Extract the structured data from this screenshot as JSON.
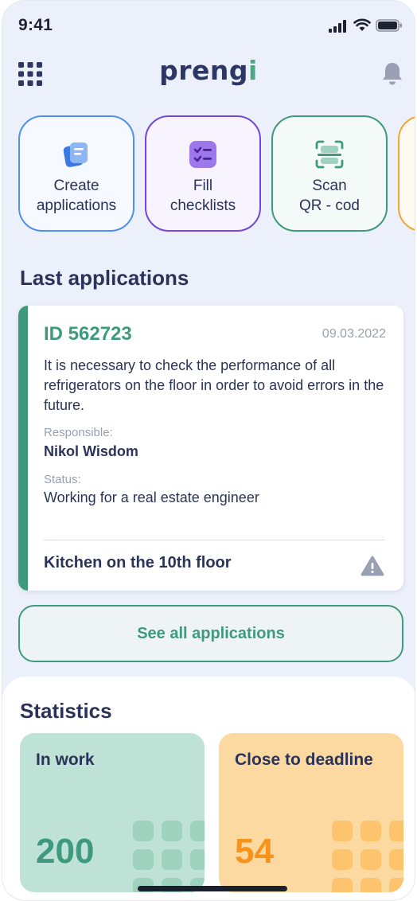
{
  "status_bar": {
    "time": "9:41"
  },
  "header": {
    "logo_text": "prengi",
    "logo_main": "preng",
    "logo_accent": "i"
  },
  "quick_actions": [
    {
      "label": "Create\napplications",
      "icon": "document-icon",
      "color": "#4e8ff0"
    },
    {
      "label": "Fill\nchecklists",
      "icon": "checklist-icon",
      "color": "#7446d8"
    },
    {
      "label": "Scan\nQR - cod",
      "icon": "qr-scan-icon",
      "color": "#3f9a7d"
    },
    {
      "label": "",
      "icon": "",
      "color": "#f3a534"
    }
  ],
  "last_applications": {
    "title": "Last applications",
    "item": {
      "id": "ID 562723",
      "date": "09.03.2022",
      "description": "It is necessary to check the performance of all refrigerators on the floor in order to avoid errors in the future.",
      "responsible_label": "Responsible:",
      "responsible": "Nikol Wisdom",
      "status_label": "Status:",
      "status": "Working for a real estate engineer",
      "location": "Kitchen on the 10th floor"
    },
    "see_all_label": "See all applications"
  },
  "statistics": {
    "title": "Statistics",
    "cards": [
      {
        "title": "In work",
        "value": "200",
        "color": "#3f9a7d"
      },
      {
        "title": "Close to deadline",
        "value": "54",
        "color": "#f7931a"
      }
    ]
  }
}
